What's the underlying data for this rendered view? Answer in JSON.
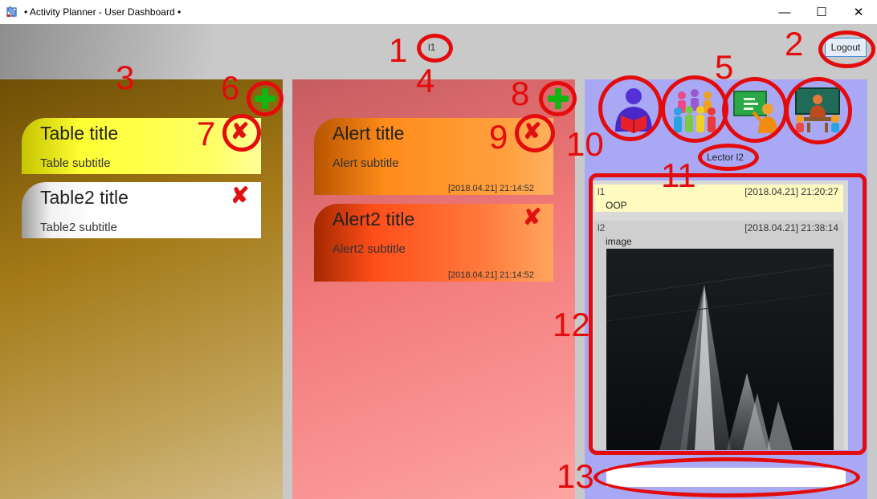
{
  "window": {
    "title": "• Activity Planner - User Dashboard •",
    "minimize": "—",
    "maximize": "☐",
    "close": "✕"
  },
  "header": {
    "user": "l1",
    "logout_label": "Logout"
  },
  "tables": [
    {
      "title": "Table title",
      "subtitle": "Table subtitle"
    },
    {
      "title": "Table2 title",
      "subtitle": "Table2 subtitle"
    }
  ],
  "alerts": [
    {
      "title": "Alert title",
      "subtitle": "Alert subtitle",
      "time": "[2018.04.21] 21:14:52"
    },
    {
      "title": "Alert2 title",
      "subtitle": "Alert2 subtitle",
      "time": "[2018.04.21] 21:14:52"
    }
  ],
  "roles": {
    "icons": [
      "reader-icon",
      "group-icon",
      "lecturer-icon",
      "classroom-icon"
    ],
    "selected_label": "Lector l2"
  },
  "posts": [
    {
      "user": "l1",
      "time": "[2018.04.21] 21:20:27",
      "text": "OOP"
    },
    {
      "user": "l2",
      "time": "[2018.04.21] 21:38:14",
      "text": "image"
    }
  ],
  "message_input": {
    "value": ""
  },
  "annotations": [
    "1",
    "2",
    "3",
    "4",
    "5",
    "6",
    "7",
    "8",
    "9",
    "10",
    "11",
    "12",
    "13"
  ],
  "colors": {
    "annotation": "#e30b0b",
    "add": "#13b513",
    "delete": "#e01010",
    "table_card_1": "#ffff33",
    "alert_card_1": "#ff8c1a",
    "right_panel": "#a9a8f5"
  }
}
